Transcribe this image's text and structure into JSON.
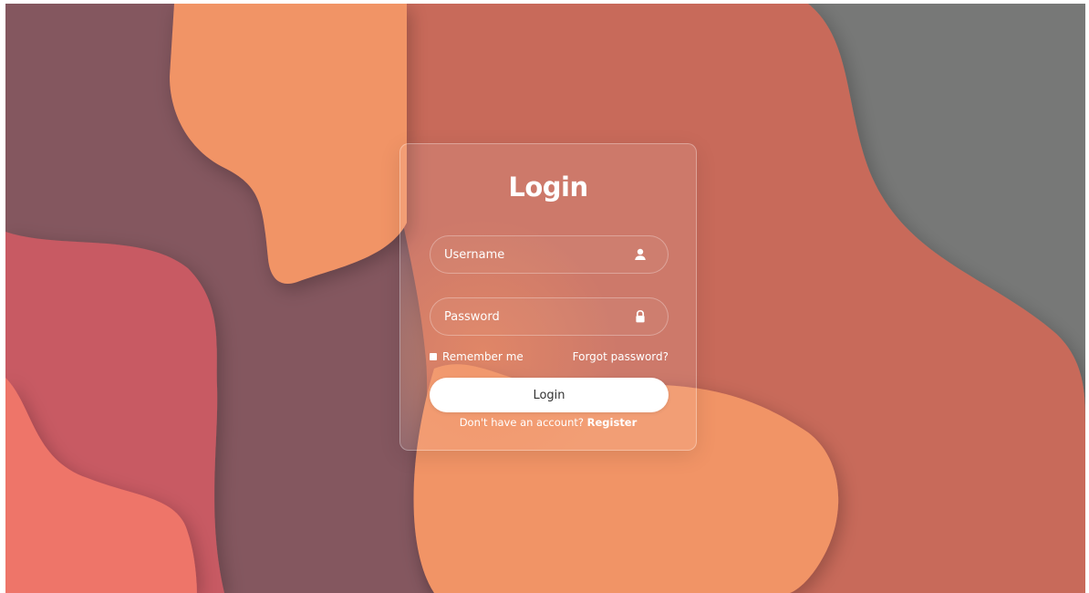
{
  "form": {
    "title": "Login",
    "username": {
      "placeholder": "Username",
      "value": "",
      "icon": "user-icon"
    },
    "password": {
      "placeholder": "Password",
      "value": "",
      "icon": "lock-icon"
    },
    "remember_label": "Remember me",
    "forgot_label": "Forgot password?",
    "submit_label": "Login",
    "register_prompt": "Don't have an account?",
    "register_label": "Register"
  },
  "colors": {
    "background_gray": "#777877",
    "plum": "#84575F",
    "salmon": "#C86B5A",
    "orange": "#F19466",
    "rose": "#C85A63",
    "coral": "#EE7469",
    "button": "#FFFFFF",
    "text": "#FFFFFF"
  }
}
